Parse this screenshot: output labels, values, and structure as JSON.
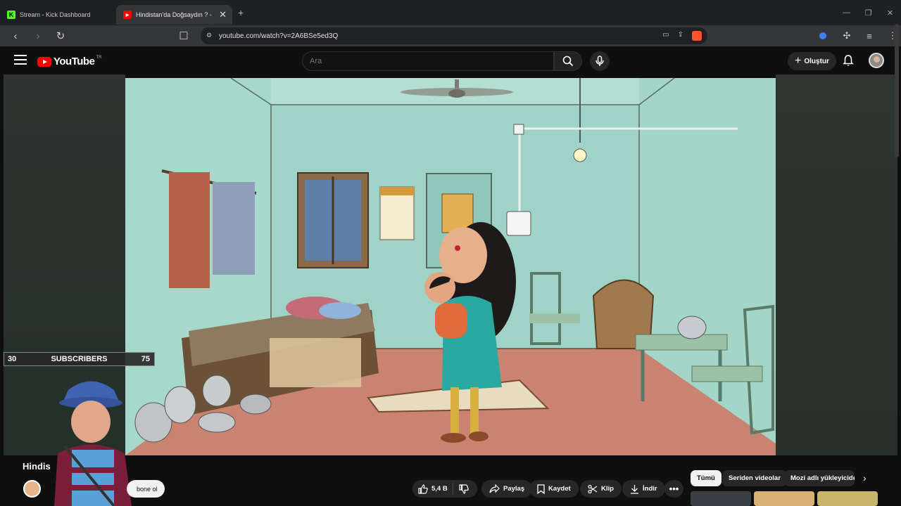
{
  "browser": {
    "tabs": [
      {
        "title": "Stream - Kick Dashboard",
        "favicon": "kick-icon",
        "active": false
      },
      {
        "title": "Hindistan'da Doğsaydın ? -",
        "favicon": "youtube-icon",
        "active": true
      }
    ],
    "url": "youtube.com/watch?v=2A6BSe5ed3Q"
  },
  "youtube": {
    "logo_text": "YouTube",
    "region": "TR",
    "search_placeholder": "Ara",
    "create_label": "Oluştur"
  },
  "overlay": {
    "sub_count_left": "30",
    "sub_label": "SUBSCRIBERS",
    "sub_goal": "75"
  },
  "video": {
    "title_visible": "Hindis",
    "subscribe_label": "bone ol",
    "likes": "5,4 B",
    "actions": {
      "share": "Paylaş",
      "save": "Kaydet",
      "clip": "Klip",
      "download": "İndir"
    }
  },
  "chips": [
    "Tümü",
    "Seriden videolar",
    "Mozi adlı yükleyiciden"
  ],
  "colors": {
    "accent": "#ff0000",
    "wall": "#9fd3c7",
    "floor": "#c98370"
  }
}
